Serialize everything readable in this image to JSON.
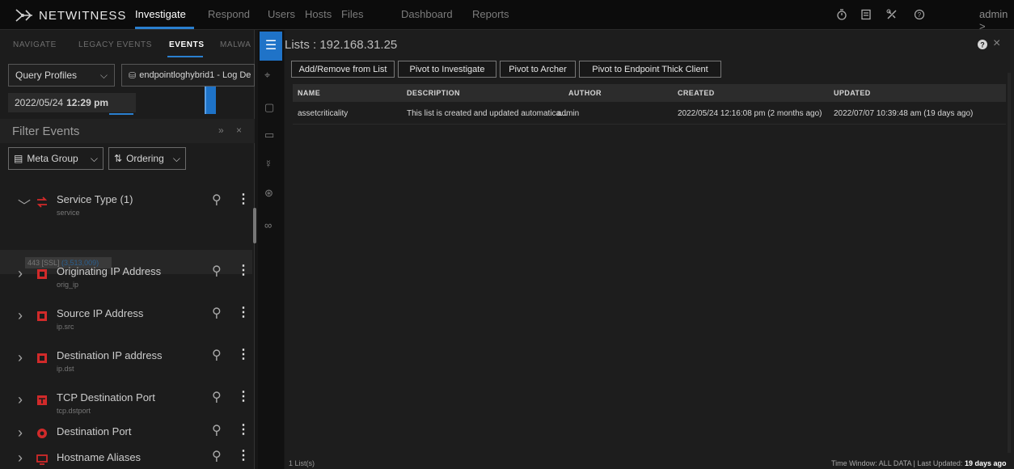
{
  "app": {
    "brand": "NETWITNESS",
    "nav": [
      "Investigate",
      "Respond",
      "Users",
      "Hosts",
      "Files",
      "Dashboard",
      "Reports"
    ],
    "active_nav": "Investigate",
    "user": "admin >",
    "top_icons": [
      "timer-icon",
      "notes-icon",
      "tools-icon",
      "help-icon"
    ]
  },
  "left_panel": {
    "tabs": [
      "NAVIGATE",
      "LEGACY EVENTS",
      "EVENTS",
      "MALWA"
    ],
    "active_tab": "EVENTS",
    "query_profiles": "Query Profiles",
    "service": "endpointloghybrid1 - Log De",
    "time_date": "2022/05/24",
    "time_clock": "12:29 pm",
    "filter_title": "Filter Events",
    "filter_expand": "»",
    "filter_close": "×",
    "meta_group": "Meta Group",
    "ordering": "Ordering",
    "meta_values_text": "443 [SSL]",
    "meta_values_count": "(3,513,009)",
    "meta_keys": [
      {
        "name": "Service Type (1)",
        "key": "service",
        "expanded": true,
        "icon": "service-type-icon"
      },
      {
        "name": "Originating IP Address",
        "key": "orig_ip",
        "expanded": false,
        "icon": "ip-icon"
      },
      {
        "name": "Source IP Address",
        "key": "ip.src",
        "expanded": false,
        "icon": "ip-icon"
      },
      {
        "name": "Destination IP address",
        "key": "ip.dst",
        "expanded": false,
        "icon": "ip-icon"
      },
      {
        "name": "TCP Destination Port",
        "key": "tcp.dstport",
        "expanded": false,
        "icon": "tcp-icon"
      },
      {
        "name": "Destination Port",
        "key": "",
        "expanded": false,
        "icon": "port-icon"
      },
      {
        "name": "Hostname Aliases",
        "key": "",
        "expanded": false,
        "icon": "host-icon"
      }
    ]
  },
  "rail": {
    "icons": [
      "list-icon",
      "pivot-icon",
      "chat-icon",
      "contacts-icon",
      "bug-icon",
      "target-icon",
      "binoculars-icon"
    ]
  },
  "lists_panel": {
    "title": "Lists : 192.168.31.25",
    "buttons": [
      "Add/Remove from List",
      "Pivot to Investigate",
      "Pivot to Archer",
      "Pivot to Endpoint Thick Client"
    ],
    "columns": [
      "NAME",
      "DESCRIPTION",
      "AUTHOR",
      "CREATED",
      "UPDATED"
    ],
    "rows": [
      {
        "name": "assetcriticality",
        "description": "This list is created and updated automatica...",
        "author": "admin",
        "created": "2022/05/24 12:16:08 pm (2 months ago)",
        "updated": "2022/07/07 10:39:48 am (19 days ago)"
      }
    ],
    "count": "1 List(s)",
    "footer_status": "Time Window: ALL DATA | Last Updated:",
    "footer_status_bold": "19 days ago"
  },
  "colors": {
    "accent": "#2a7fcf",
    "meta_icon_red": "#d12a2a",
    "bg": "#161616"
  }
}
